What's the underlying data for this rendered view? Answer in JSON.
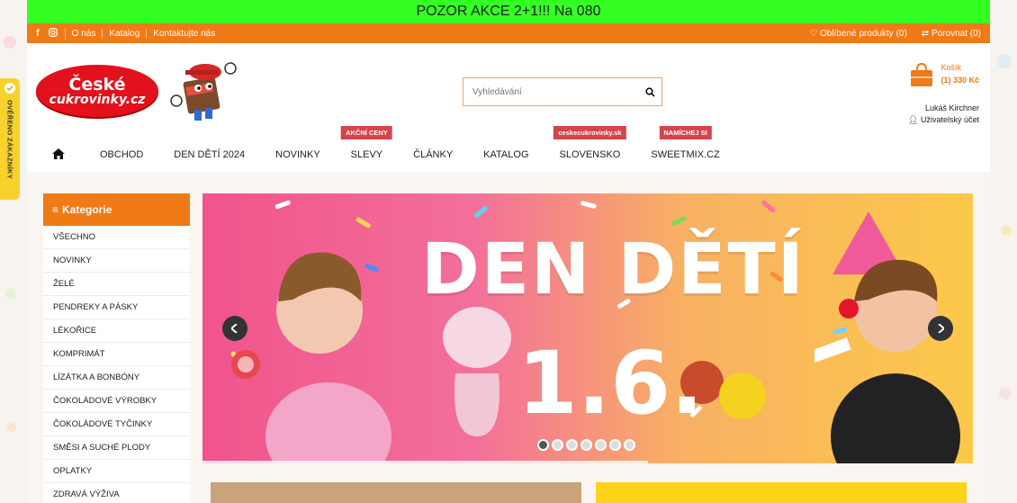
{
  "promo": {
    "text": "POZOR AKCE 2+1!!! Na 080"
  },
  "topbar": {
    "links": [
      "O nás",
      "Katalog",
      "Kontaktujte nás"
    ],
    "favorites": "Oblíbené produkty (0)",
    "compare": "Porovnat (0)"
  },
  "header": {
    "logo_line1": "České",
    "logo_line2": "cukrovinky.cz",
    "search_placeholder": "Vyhledávání",
    "cart_label": "Košík",
    "cart_summary": "(1) 330 Kč",
    "user_name": "Lukáš Kirchner",
    "account_label": "Uživatelský účet"
  },
  "nav": {
    "items": [
      "OBCHOD",
      "DEN DĚTÍ 2024",
      "NOVINKY",
      "SLEVY",
      "ČLÁNKY",
      "KATALOG",
      "SLOVENSKO",
      "SWEETMIX.CZ"
    ],
    "badges": {
      "slevy": "AKČNÍ CENY",
      "slovensko": "ceskecukrovinky.sk",
      "sweetmix": "NAMÍCHEJ SI"
    }
  },
  "sidebar": {
    "title": "Kategorie",
    "items": [
      "VŠECHNO",
      "NOVINKY",
      "ŽELÉ",
      "PENDREKY A PÁSKY",
      "LÉKOŘICE",
      "KOMPRIMÁT",
      "LÍZÁTKA A BONBÓNY",
      "ČOKOLÁDOVÉ VÝROBKY",
      "ČOKOLÁDOVÉ TYČINKY",
      "SMĚSI A SUCHÉ PLODY",
      "OPLATKY",
      "ZDRAVÁ VÝŽIVA"
    ]
  },
  "banner": {
    "title": "DEN DĚTÍ",
    "date": "1.6.",
    "slide_count": 7,
    "active_slide": 1
  },
  "verified": {
    "label": "OVĚŘENO ZÁKAZNÍKY"
  },
  "colors": {
    "accent": "#f07a15",
    "promo_green": "#33ff22",
    "badge_red": "#d4444b",
    "logo_red": "#e3111b"
  }
}
